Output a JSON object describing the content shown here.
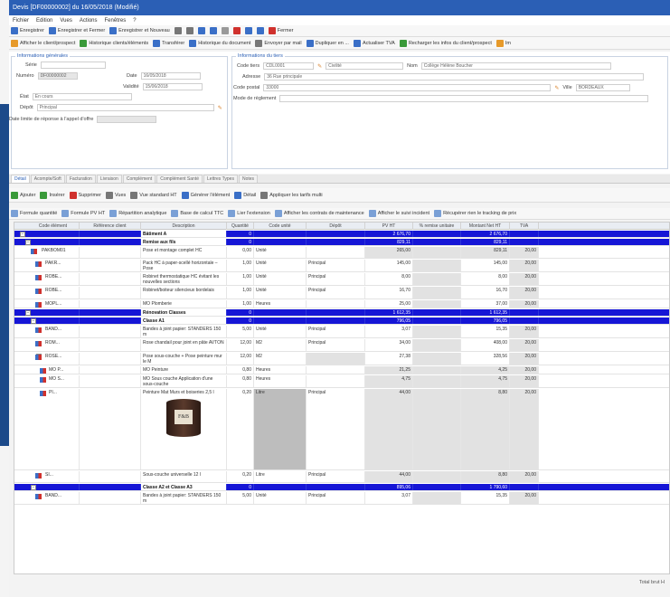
{
  "window": {
    "title": "Devis [DF00000002] du 16/05/2018 (Modifié)"
  },
  "menu": [
    "Fichier",
    "Edition",
    "Vues",
    "Actions",
    "Fenêtres",
    "?"
  ],
  "toolbar1": [
    {
      "label": "Enregistrer",
      "icon": "save-icon",
      "color": "#3a6fc7"
    },
    {
      "label": "Enregistrer et Fermer",
      "icon": "save-close-icon",
      "color": "#3a6fc7"
    },
    {
      "label": "Enregistrer et Nouveau",
      "icon": "save-new-icon",
      "color": "#3a6fc7"
    },
    {
      "label": "",
      "icon": "print-icon",
      "color": "#777"
    },
    {
      "label": "",
      "icon": "preview-icon",
      "color": "#777"
    },
    {
      "label": "",
      "icon": "back-icon",
      "color": "#3a6fc7"
    },
    {
      "label": "",
      "icon": "forward-icon",
      "color": "#3a6fc7"
    },
    {
      "label": "",
      "icon": "copy-icon",
      "color": "#999"
    },
    {
      "label": "",
      "icon": "delete-icon",
      "color": "#d0312d"
    },
    {
      "label": "",
      "icon": "info-icon",
      "color": "#3a6fc7"
    },
    {
      "label": "",
      "icon": "help-icon",
      "color": "#3a6fc7"
    },
    {
      "label": "Fermer",
      "icon": "close-icon",
      "color": "#d0312d"
    }
  ],
  "toolbar2": [
    {
      "label": "Afficher le client/prospect",
      "icon": "person-icon",
      "color": "#e79a2a"
    },
    {
      "label": "Historique clients/éléments",
      "icon": "history-icon",
      "color": "#3a9a3a"
    },
    {
      "label": "Transférer",
      "icon": "transfer-icon",
      "color": "#3a6fc7"
    },
    {
      "label": "Historique du document",
      "icon": "doc-history-icon",
      "color": "#3a6fc7"
    },
    {
      "label": "Envoyer par mail",
      "icon": "mail-icon",
      "color": "#777"
    },
    {
      "label": "Dupliquer en ...",
      "icon": "duplicate-icon",
      "color": "#3a6fc7"
    },
    {
      "label": "Actualiser TVA",
      "icon": "refresh-icon",
      "color": "#3a6fc7"
    },
    {
      "label": "Recharger les infos du client/prospect",
      "icon": "reload-icon",
      "color": "#3a9a3a"
    },
    {
      "label": "Im",
      "icon": "import-icon",
      "color": "#e79a2a"
    }
  ],
  "form": {
    "general_title": "Informations générales",
    "serie_label": "Série",
    "numero_label": "Numéro",
    "numero_value": "DF00000002",
    "date_label": "Date",
    "date_value": "16/05/2018",
    "validite_label": "Validité",
    "validite_value": "15/06/2018",
    "etat_label": "État",
    "etat_value": "En cours",
    "depot_label": "Dépôt",
    "depot_value": "Principal",
    "appel_label": "Date limite de réponse à l'appel d'offre",
    "tiers_title": "Informations du tiers",
    "code_tiers_label": "Code tiers",
    "code_tiers_value": "CDL0001",
    "civilite_value": "Civilité",
    "nom_label": "Nom",
    "nom_value": "Collège Hélène Boucher",
    "adresse_label": "Adresse",
    "adresse_value": "36 Rue principale",
    "cp_label": "Code postal",
    "cp_value": "33000",
    "ville_label": "Ville",
    "ville_value": "BORDEAUX",
    "reglement_label": "Mode de règlement"
  },
  "tabs": [
    "Détail",
    "Acompte/Soft",
    "Facturation",
    "Livraison",
    "Complément",
    "Complément Santé",
    "Lettres Types",
    "Notes"
  ],
  "detail_toolbar": [
    {
      "label": "Ajouter",
      "icon": "add-icon",
      "color": "#3a9a3a"
    },
    {
      "label": "Insérer",
      "icon": "insert-icon",
      "color": "#3a9a3a"
    },
    {
      "label": "Supprimer",
      "icon": "delete-row-icon",
      "color": "#d0312d"
    },
    {
      "label": "Vues",
      "icon": "view-icon",
      "color": "#777"
    },
    {
      "label": "Vue standard HT",
      "icon": "view-select-icon",
      "color": "#777"
    },
    {
      "label": "Générer l'élément",
      "icon": "generate-icon",
      "color": "#3a6fc7"
    },
    {
      "label": "Détail",
      "icon": "detail-icon",
      "color": "#3a6fc7"
    },
    {
      "label": "Appliquer les tarifs multi",
      "icon": "tariff-icon",
      "color": "#777"
    }
  ],
  "detail_toolbar2": [
    {
      "label": "Formule quantité",
      "icon": "formula-icon"
    },
    {
      "label": "Formule PV HT",
      "icon": "formula2-icon"
    },
    {
      "label": "Répartition analytique",
      "icon": "analytic-icon"
    },
    {
      "label": "Base de calcul TTC",
      "icon": "base-icon"
    },
    {
      "label": "Lier l'extension",
      "icon": "link-icon"
    },
    {
      "label": "Afficher les contrats de maintenance",
      "icon": "contract-icon"
    },
    {
      "label": "Afficher le suivi incident",
      "icon": "incident-icon"
    },
    {
      "label": "Récupérer rien le tracking de prix",
      "icon": "tracking-icon"
    }
  ],
  "columns": [
    "Code élément",
    "Référence client",
    "Description",
    "Quantité",
    "Code unité",
    "Dépôt",
    "PV HT",
    "% remise unitaire",
    "Montant Net HT",
    "TVA"
  ],
  "rows": [
    {
      "type": "section",
      "level": 0,
      "desc": "Bâtiment A",
      "qty": "0",
      "pv": "2 676,70",
      "net": "2 676,70",
      "exp": "-"
    },
    {
      "type": "section",
      "level": 1,
      "desc": "Remise aux fils",
      "qty": "0",
      "pv": "829,11",
      "net": "829,11",
      "exp": "-"
    },
    {
      "type": "item",
      "level": 2,
      "code": "PAKBOM01",
      "desc": "Pose et montage complet HC",
      "qty": "0,00",
      "unit": "Unité",
      "depot": "",
      "pv": "265,00",
      "net": "829,11",
      "tva": "20,00",
      "shade": true
    },
    {
      "type": "item",
      "level": 3,
      "code": "PAKR...",
      "desc": "Pack HC à paper-scellé horizontale – Pose",
      "qty": "1,00",
      "unit": "Unité",
      "depot": "Principal",
      "pv": "145,00",
      "net": "145,00",
      "tva": "20,00"
    },
    {
      "type": "item",
      "level": 3,
      "code": "ROBE...",
      "desc": "Robinet thermostatique HC évitant les nouvelles sections",
      "qty": "1,00",
      "unit": "Unité",
      "depot": "Principal",
      "pv": "8,00",
      "net": "8,00",
      "tva": "20,00"
    },
    {
      "type": "item",
      "level": 3,
      "code": "ROBE...",
      "desc": "Robinet/boiteur silencieux bordelais",
      "qty": "1,00",
      "unit": "Unité",
      "depot": "Principal",
      "pv": "16,70",
      "net": "16,70",
      "tva": "20,00"
    },
    {
      "type": "item",
      "level": 3,
      "code": "MOPL...",
      "desc": "MO Plomberie",
      "qty": "1,00",
      "unit": "Heures",
      "depot": "",
      "pv": "25,00",
      "net": "37,00",
      "tva": "20,00"
    },
    {
      "type": "section",
      "level": 1,
      "desc": "Rénovation Classes",
      "qty": "0",
      "pv": "1 612,35",
      "net": "1 612,35",
      "exp": "-"
    },
    {
      "type": "section",
      "level": 2,
      "desc": "Classe A1",
      "qty": "0",
      "pv": "796,05",
      "net": "796,05",
      "exp": "-"
    },
    {
      "type": "item",
      "level": 3,
      "code": "BAND...",
      "desc": "Bandes à joint papier: STANDERS 150 m",
      "qty": "5,00",
      "unit": "Unité",
      "depot": "Principal",
      "pv": "3,07",
      "net": "15,35",
      "tva": "20,00"
    },
    {
      "type": "item",
      "level": 3,
      "code": "ROM...",
      "desc": "Rose chandail pour joint en pâte AVTON",
      "qty": "12,00",
      "unit": "M2",
      "depot": "Principal",
      "pv": "34,00",
      "net": "408,00",
      "tva": "20,00"
    },
    {
      "type": "item",
      "level": 3,
      "code": "ROSE...",
      "desc": "Pose sous-couche + Pose peinture mur le M",
      "qty": "12,00",
      "unit": "M2",
      "depot": "",
      "pv": "27,38",
      "net": "328,56",
      "tva": "20,00",
      "exp": "-",
      "shadeDepot": true
    },
    {
      "type": "item",
      "level": 4,
      "code": "MO P...",
      "desc": "MO Peinture",
      "qty": "0,80",
      "unit": "Heures",
      "depot": "",
      "pv": "21,25",
      "net": "4,25",
      "tva": "20,00",
      "shade": true
    },
    {
      "type": "item",
      "level": 4,
      "code": "MO S...",
      "desc": "MO Sous couche Application d'une sous-couche",
      "qty": "0,80",
      "unit": "Heures",
      "depot": "",
      "pv": "4,75",
      "net": "4,75",
      "tva": "20,00",
      "shade": true
    },
    {
      "type": "paint",
      "level": 4,
      "code": "PI...",
      "desc": "Peinture Mat Murs et boiseries 2,5 l",
      "qty": "0,20",
      "unit": "Litre",
      "depot": "Principal",
      "pv": "44,00",
      "net": "8,80",
      "tva": "20,00"
    },
    {
      "type": "item",
      "level": 3,
      "code": "SI...",
      "desc": "Sous-couche universelle 12 l",
      "qty": "0,20",
      "unit": "Litre",
      "depot": "Principal",
      "pv": "44,00",
      "net": "8,80",
      "tva": "20,00",
      "shade": true
    },
    {
      "type": "section",
      "level": 2,
      "desc": "Classe A2 et Classe A3",
      "qty": "0",
      "pv": "895,06",
      "net": "1 790,60",
      "exp": "-"
    },
    {
      "type": "item",
      "level": 3,
      "code": "BAND...",
      "desc": "Bandes à joint papier: STANDERS 150 m",
      "qty": "5,00",
      "unit": "Unité",
      "depot": "Principal",
      "pv": "3,07",
      "net": "15,35",
      "tva": "20,00"
    }
  ],
  "paint_label": "F&B",
  "status": {
    "total": "Total brut H"
  }
}
